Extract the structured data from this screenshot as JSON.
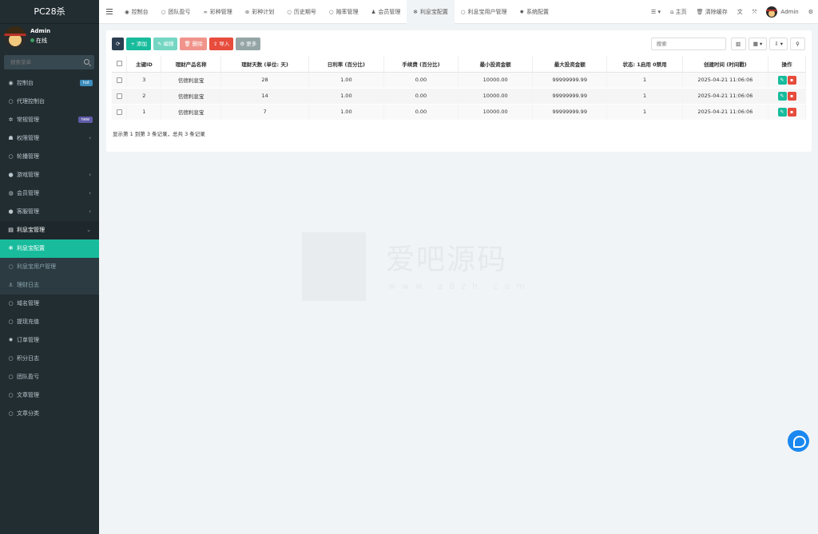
{
  "app": {
    "title": "PC28杀"
  },
  "user": {
    "name": "Admin",
    "status": "在线"
  },
  "sidebar": {
    "search_placeholder": "搜索菜单",
    "items": [
      {
        "label": "控制台",
        "icon": "dashboard-icon",
        "glyph": "◉",
        "badge": "hot",
        "badge_color": "#3c8dbc"
      },
      {
        "label": "代理控制台",
        "icon": "circle-icon",
        "glyph": "○"
      },
      {
        "label": "常规管理",
        "icon": "cogs-icon",
        "glyph": "✲",
        "badge": "new",
        "badge_color": "#605ca8"
      },
      {
        "label": "权限管理",
        "icon": "group-icon",
        "glyph": "☗",
        "arrow": "‹"
      },
      {
        "label": "轮播管理",
        "icon": "circle-icon",
        "glyph": "○"
      },
      {
        "label": "游戏管理",
        "icon": "game-icon",
        "glyph": "●",
        "arrow": "‹"
      },
      {
        "label": "会员管理",
        "icon": "user-circle-icon",
        "glyph": "◍",
        "arrow": "‹"
      },
      {
        "label": "客服管理",
        "icon": "chat-icon",
        "glyph": "●",
        "arrow": "‹"
      },
      {
        "label": "利息宝管理",
        "icon": "list-icon",
        "glyph": "▤",
        "arrow": "⌄",
        "state": "open"
      },
      {
        "label": "利息宝配置",
        "icon": "cubes-icon",
        "glyph": "✻",
        "state": "active"
      },
      {
        "label": "利息宝用户管理",
        "icon": "circle-icon",
        "glyph": "○",
        "state": "sub"
      },
      {
        "label": "理财日志",
        "icon": "anchor-icon",
        "glyph": "⚓",
        "state": "sub"
      },
      {
        "label": "域名管理",
        "icon": "circle-icon",
        "glyph": "○"
      },
      {
        "label": "提现充值",
        "icon": "circle-icon",
        "glyph": "○"
      },
      {
        "label": "订单管理",
        "icon": "gear-icon",
        "glyph": "✹"
      },
      {
        "label": "积分日志",
        "icon": "circle-icon",
        "glyph": "○"
      },
      {
        "label": "团队盈亏",
        "icon": "circle-icon",
        "glyph": "○"
      },
      {
        "label": "文章管理",
        "icon": "circle-icon",
        "glyph": "○"
      },
      {
        "label": "文章分类",
        "icon": "circle-icon",
        "glyph": "○"
      }
    ]
  },
  "topnav": {
    "tabs": [
      {
        "label": "控制台",
        "icon": "dashboard-icon",
        "glyph": "◉"
      },
      {
        "label": "团队盈亏",
        "icon": "circle-icon",
        "glyph": "○"
      },
      {
        "label": "彩种管理",
        "icon": "gamepad-icon",
        "glyph": "∞"
      },
      {
        "label": "彩种计划",
        "icon": "life-ring-icon",
        "glyph": "⊛"
      },
      {
        "label": "历史期号",
        "icon": "circle-icon",
        "glyph": "○"
      },
      {
        "label": "赔率管理",
        "icon": "circle-icon",
        "glyph": "○"
      },
      {
        "label": "会员管理",
        "icon": "user-icon",
        "glyph": "♟"
      },
      {
        "label": "利息宝配置",
        "icon": "cubes-icon",
        "glyph": "✻",
        "active": true
      },
      {
        "label": "利息宝用户管理",
        "icon": "circle-icon",
        "glyph": "○"
      },
      {
        "label": "系统配置",
        "icon": "gear-icon",
        "glyph": "✹"
      }
    ],
    "right": {
      "menu_glyph": "☰ ▾",
      "home": "主页",
      "clear_cache": "清除缓存",
      "translate_glyph": "文",
      "fullscreen_glyph": "⤧",
      "user": "Admin",
      "settings_glyph": "⚙"
    }
  },
  "toolbar": {
    "refresh_glyph": "⟳",
    "add": "+ 添加",
    "edit": "✎ 编辑",
    "delete": "🗑 删除",
    "import": "⇪ 导入",
    "more": "⚙ 更多",
    "search_placeholder": "搜索",
    "toggle_glyph": "▥",
    "columns_glyph": "▦ ▾",
    "export_glyph": "⇩ ▾",
    "adv_search_glyph": "⚲"
  },
  "table": {
    "headers": [
      "主键ID",
      "理财产品名称",
      "理财天数 (单位: 天)",
      "日利率 (百分比)",
      "手续费 (百分比)",
      "最小投资金额",
      "最大投资金额",
      "状态: 1启用 0禁用",
      "创建时间 (时间戳)",
      "操作"
    ],
    "rows": [
      [
        "3",
        "信德利息宝",
        "28",
        "1.00",
        "0.00",
        "10000.00",
        "99999999.99",
        "1",
        "2025-04-21 11:06:06"
      ],
      [
        "2",
        "信德利息宝",
        "14",
        "1.00",
        "0.00",
        "10000.00",
        "99999999.99",
        "1",
        "2025-04-21 11:06:06"
      ],
      [
        "1",
        "信德利息宝",
        "7",
        "1.00",
        "0.00",
        "10000.00",
        "99999999.99",
        "1",
        "2025-04-21 11:06:06"
      ]
    ],
    "footer": "显示第 1 到第 3 条记录，总共 3 条记录"
  },
  "watermark": {
    "text": "爱吧源码",
    "url": "www.a8zh.com"
  },
  "colors": {
    "sidebar_bg": "#222d32",
    "accent": "#18bc9c",
    "danger": "#e74c3c",
    "primary_dark": "#2c3e50"
  }
}
